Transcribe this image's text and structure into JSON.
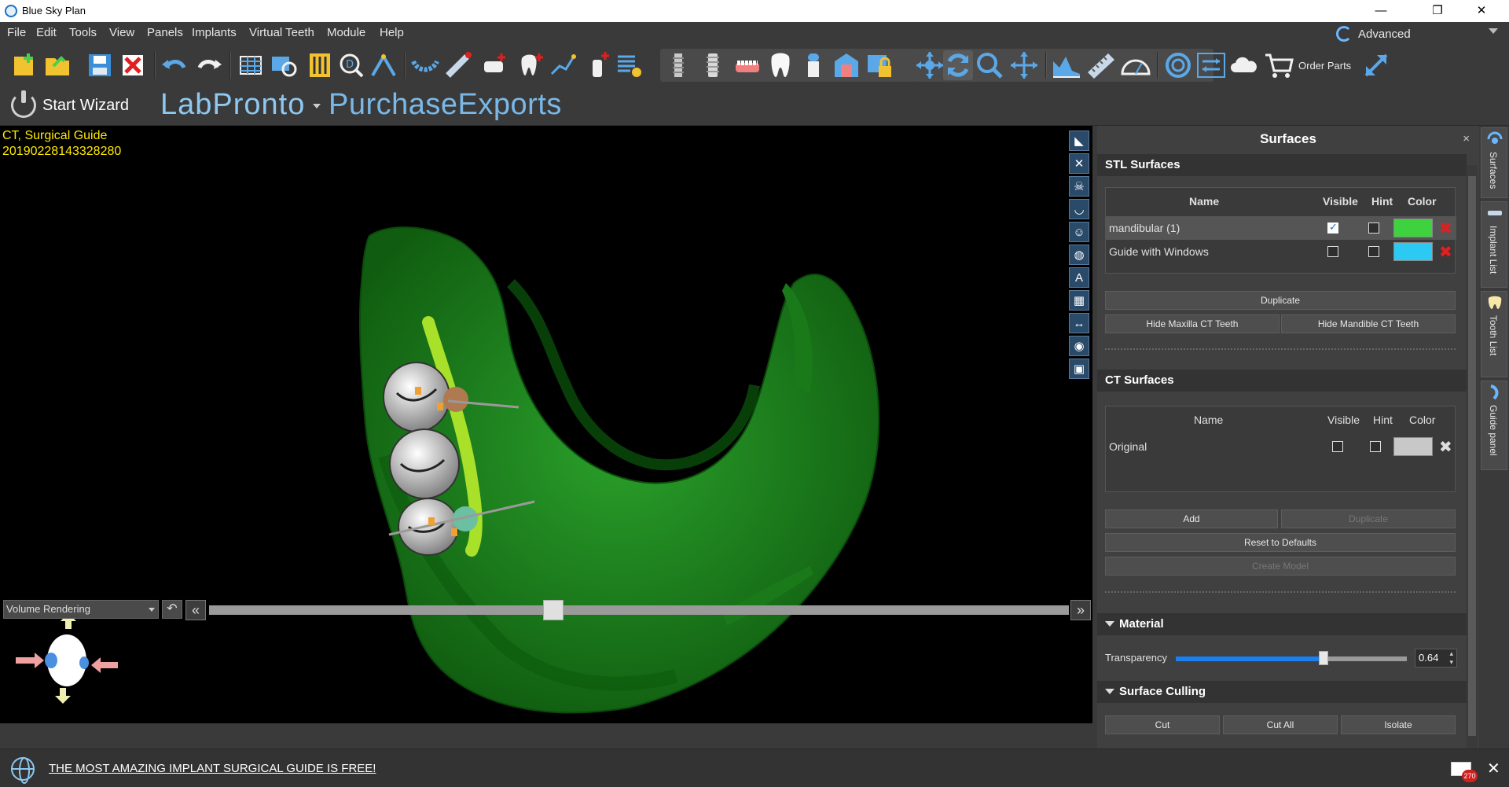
{
  "window": {
    "title": "Blue Sky Plan",
    "controls": {
      "minimize": "—",
      "maximize": "❐",
      "close": "✕"
    }
  },
  "menu": {
    "items": [
      "File",
      "Edit",
      "Tools",
      "View",
      "Panels",
      "Implants",
      "Virtual Teeth",
      "Module",
      "Help"
    ],
    "mode": "Advanced"
  },
  "toolbar": {
    "order_parts": "Order Parts",
    "icons": [
      "new-file-icon",
      "open-file-icon",
      "save-icon",
      "close-file-icon",
      "undo-icon",
      "redo-icon",
      "layout-icon",
      "slice-view-icon",
      "sliders-icon",
      "dicom-search-icon",
      "nerve-icon",
      "arch-icon",
      "ruler-tool-icon",
      "add-crown-icon",
      "add-tooth-icon",
      "measure-path-icon",
      "add-implant-icon",
      "list-settings-icon",
      "implant-icon",
      "implant-screw-icon",
      "denture-icon",
      "tooth-icon",
      "sleeve-icon",
      "model-icon",
      "lock-icon",
      "move-icon",
      "rotate-icon",
      "zoom-icon",
      "pan-icon",
      "histogram-icon",
      "ruler-icon",
      "protractor-icon",
      "spiral-icon",
      "transfer-icon",
      "cloud-icon",
      "cart-icon",
      "fullscreen-icon"
    ],
    "colors": {
      "blue": "#5aa8e8",
      "yellow": "#f2c330",
      "red": "#e02020",
      "white": "#f0f0f0"
    }
  },
  "secondbar": {
    "start_wizard": "Start Wizard",
    "labpronto": "LabPronto",
    "purchase_exports": "PurchaseExports"
  },
  "viewport": {
    "info_line1": "CT, Surgical Guide",
    "info_line2": "20190228143328280",
    "render_mode": "Volume Rendering",
    "tools": [
      "slice-icon",
      "cross-icon",
      "skull-icon",
      "arch-view-icon",
      "face-icon",
      "sphere-icon",
      "text-icon",
      "grid-icon",
      "distance-icon",
      "ds-icon",
      "camera-icon"
    ],
    "model_color": "#1e8a1e",
    "slider_fraction": 0.4
  },
  "panel": {
    "title": "Surfaces",
    "close": "×",
    "stl": {
      "title": "STL Surfaces",
      "headers": {
        "name": "Name",
        "visible": "Visible",
        "hint": "Hint",
        "color": "Color"
      },
      "rows": [
        {
          "name": "mandibular (1)",
          "visible": true,
          "hint": false,
          "color": "#3fd23f"
        },
        {
          "name": "Guide with Windows",
          "visible": false,
          "hint": false,
          "color": "#2ccaf2"
        }
      ],
      "delete_glyph": "✖",
      "buttons": {
        "duplicate": "Duplicate",
        "hide_maxilla": "Hide Maxilla CT Teeth",
        "hide_mandible": "Hide Mandible CT Teeth"
      }
    },
    "ct": {
      "title": "CT Surfaces",
      "headers": {
        "name": "Name",
        "visible": "Visible",
        "hint": "Hint",
        "color": "Color"
      },
      "rows": [
        {
          "name": "Original",
          "visible": false,
          "hint": false,
          "color": "#c8c8c8"
        }
      ],
      "delete_glyph": "✖",
      "buttons": {
        "add": "Add",
        "duplicate": "Duplicate",
        "reset": "Reset to Defaults",
        "create_model": "Create Model"
      }
    },
    "material": {
      "title": "Material",
      "transparency_label": "Transparency",
      "transparency_value": "0.64",
      "transparency": 0.64
    },
    "culling": {
      "title": "Surface Culling",
      "buttons": {
        "cut": "Cut",
        "cut_all": "Cut All",
        "isolate": "Isolate"
      }
    }
  },
  "sidetabs": [
    {
      "label": "Surfaces",
      "icon": "surfaces-icon"
    },
    {
      "label": "Implant List",
      "icon": "implant-list-icon"
    },
    {
      "label": "Tooth List",
      "icon": "tooth-list-icon"
    },
    {
      "label": "Guide panel",
      "icon": "guide-icon"
    }
  ],
  "status": {
    "ad_text": "THE MOST AMAZING IMPLANT SURGICAL GUIDE IS FREE!",
    "mail_count": "270",
    "close": "✕"
  }
}
